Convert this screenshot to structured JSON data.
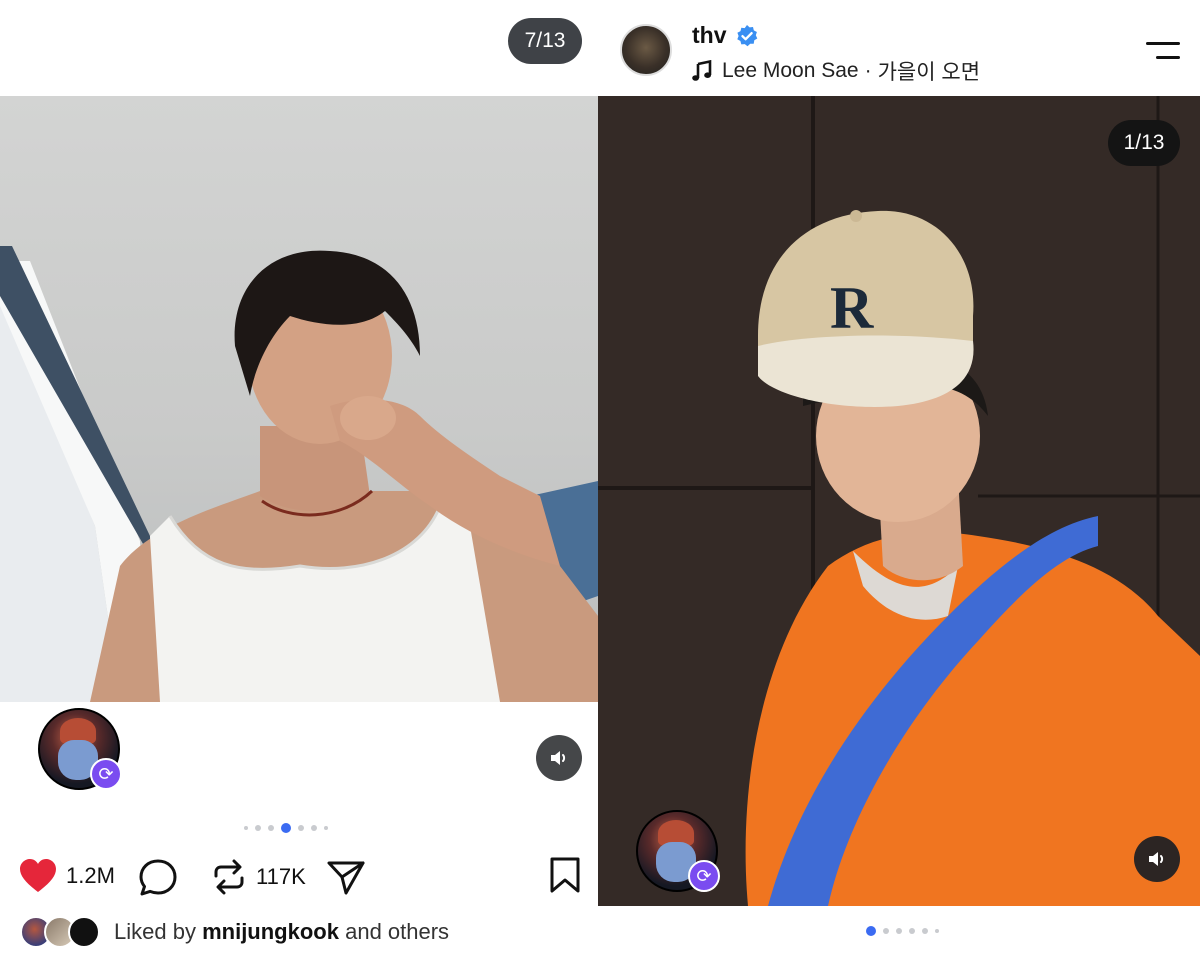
{
  "left_post": {
    "counter": "7/13",
    "photo_alt": "left-photo",
    "likes": "1.2M",
    "reposts": "117K",
    "liked_by_prefix": "Liked by",
    "liked_by_user": "mnijungkook",
    "liked_by_suffix": "and others",
    "carousel_dot_count": 7,
    "carousel_active_index": 2
  },
  "right_post": {
    "username": "thv",
    "music_artist": "Lee Moon Sae",
    "music_separator": "·",
    "music_title": "가을이 오면",
    "counter": "1/13",
    "carousel_dot_count": 6,
    "carousel_active_index": 0
  },
  "colors": {
    "heart": "#e5263a",
    "verified": "#3a8ff2",
    "active_dot": "#3b6bf2",
    "repost_badge": "#7a4cf0"
  },
  "icons": {
    "like": "heart-filled-icon",
    "comment": "speech-bubble-icon",
    "repost": "repost-arrows-icon",
    "share": "paper-plane-icon",
    "save": "bookmark-icon",
    "sound": "speaker-icon",
    "music": "music-note-icon",
    "menu": "hamburger-menu-icon",
    "verified": "verified-badge-icon"
  }
}
